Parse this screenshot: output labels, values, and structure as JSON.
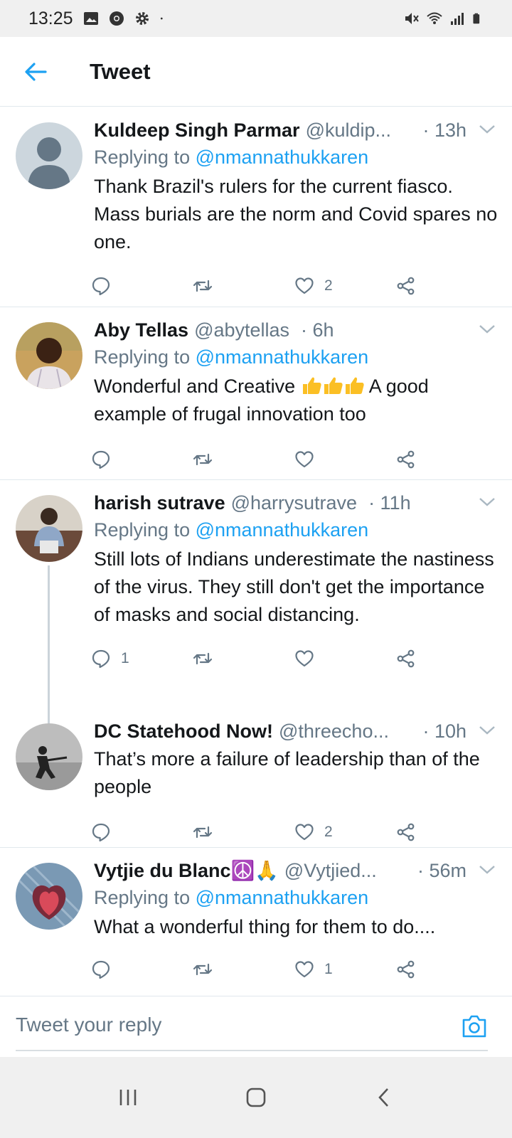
{
  "status_bar": {
    "time": "13:25"
  },
  "header": {
    "title": "Tweet"
  },
  "tweets": [
    {
      "name": "Kuldeep Singh Parmar",
      "handle": "@kuldip...",
      "time": "· 13h",
      "replying_label": "Replying to",
      "replying_to": "@nmannathukkaren",
      "text": "Thank Brazil's rulers for the current fiasco. Mass burials are the norm and Covid spares no one.",
      "reply_count": "",
      "retweet_count": "",
      "like_count": "2"
    },
    {
      "name": "Aby Tellas",
      "handle": "@abytellas",
      "time": "· 6h",
      "replying_label": "Replying to",
      "replying_to": "@nmannathukkaren",
      "text_before": "Wonderful and Creative",
      "text_after": "A good example of frugal innovation too",
      "reply_count": "",
      "retweet_count": "",
      "like_count": ""
    },
    {
      "name": "harish sutrave",
      "handle": "@harrysutrave",
      "time": "· 11h",
      "replying_label": "Replying to",
      "replying_to": "@nmannathukkaren",
      "text": "Still lots of Indians underestimate the nastiness of the virus. They still don't get the importance of masks and social distancing.",
      "reply_count": "1",
      "retweet_count": "",
      "like_count": ""
    },
    {
      "name": "DC Statehood Now!",
      "handle": "@threecho...",
      "time": "· 10h",
      "text": "That’s more a failure of leadership than of the people",
      "reply_count": "",
      "retweet_count": "",
      "like_count": "2"
    },
    {
      "name": "Vytjie du Blanc☮️🙏",
      "handle": "@Vytjied...",
      "time": "· 56m",
      "replying_label": "Replying to",
      "replying_to": "@nmannathukkaren",
      "text": "What a wonderful thing for them to do....",
      "reply_count": "",
      "retweet_count": "",
      "like_count": "1"
    }
  ],
  "reply_bar": {
    "placeholder": "Tweet your reply"
  },
  "colors": {
    "accent": "#1da1f2",
    "secondary_text": "#657786",
    "primary_text": "#14171a",
    "divider": "#e1e8ed"
  }
}
